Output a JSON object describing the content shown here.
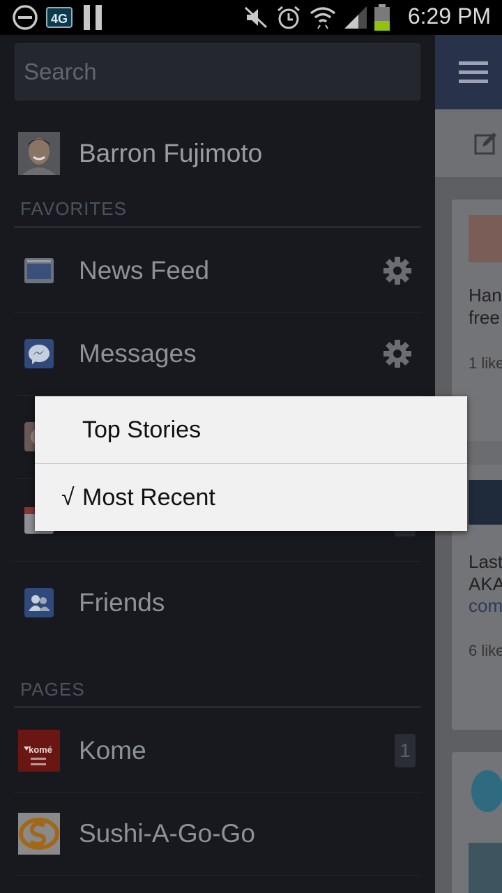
{
  "status_bar": {
    "time": "6:29 PM",
    "network_badge": "4G",
    "icons": [
      "do-not-disturb-icon",
      "4g-icon",
      "pause-icon",
      "mute-icon",
      "alarm-icon",
      "wifi-icon",
      "signal-icon",
      "battery-icon"
    ]
  },
  "drawer": {
    "search_placeholder": "Search",
    "profile_name": "Barron Fujimoto",
    "favorites_header": "FAVORITES",
    "favorites": [
      {
        "label": "News Feed",
        "icon": "news-feed-icon",
        "has_gear": true
      },
      {
        "label": "Messages",
        "icon": "messages-icon",
        "has_gear": true
      },
      {
        "label": "Friends",
        "icon": "friends-icon",
        "has_gear": false
      }
    ],
    "pages_header": "PAGES",
    "pages": [
      {
        "label": "Kome",
        "logo_text": "komé",
        "badge": "1"
      },
      {
        "label": "Sushi-A-Go-Go",
        "badge": ""
      }
    ]
  },
  "feed_preview": {
    "card1_line1": "Han",
    "card1_line2": "free",
    "card1_meta": "1 like",
    "card2_line1": "Last",
    "card2_line2": "AKA",
    "card2_link": "com",
    "card2_meta": "6 like"
  },
  "popup_menu": {
    "options": [
      {
        "label": "Top Stories",
        "checked": false
      },
      {
        "label": "Most Recent",
        "checked": true
      }
    ],
    "check_glyph": "√"
  },
  "colors": {
    "drawer_bg": "#17191e",
    "popup_bg": "#f1f1f1",
    "fb_blue": "#3b5998"
  }
}
